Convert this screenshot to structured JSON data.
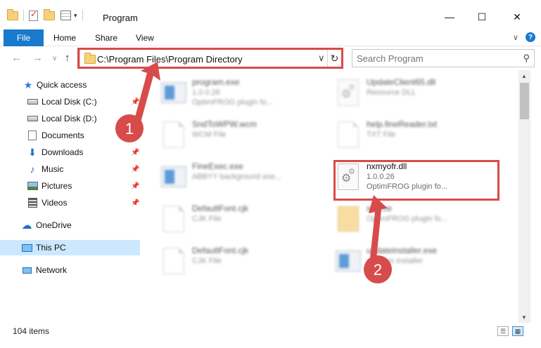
{
  "window": {
    "title": "Program",
    "minimize_glyph": "—",
    "maximize_glyph": "☐",
    "close_glyph": "✕"
  },
  "ribbon": {
    "tabs": [
      "File",
      "Home",
      "Share",
      "View"
    ],
    "expand_glyph": "∨",
    "help_glyph": "?"
  },
  "nav": {
    "back_glyph": "←",
    "forward_glyph": "→",
    "recent_glyph": "∨",
    "up_glyph": "↑",
    "address": "C:\\Program Files\\Program Directory",
    "address_dropdown_glyph": "∨",
    "refresh_glyph": "↻",
    "search_placeholder": "Search Program",
    "search_glyph": "⚲"
  },
  "sidebar": {
    "items": [
      {
        "label": "Quick access",
        "icon": "star-icon"
      },
      {
        "label": "Local Disk (C:)",
        "icon": "drive-icon"
      },
      {
        "label": "Local Disk (D:)",
        "icon": "drive-icon"
      },
      {
        "label": "Documents",
        "icon": "documents-icon"
      },
      {
        "label": "Downloads",
        "icon": "download-icon"
      },
      {
        "label": "Music",
        "icon": "music-icon"
      },
      {
        "label": "Pictures",
        "icon": "pictures-icon"
      },
      {
        "label": "Videos",
        "icon": "videos-icon"
      },
      {
        "label": "OneDrive",
        "icon": "cloud-icon"
      },
      {
        "label": "This PC",
        "icon": "computer-icon"
      },
      {
        "label": "Network",
        "icon": "network-icon"
      }
    ]
  },
  "files": [
    {
      "name": "program.exe",
      "line2": "1.0.0.26",
      "line3": "OptimFROG plugin fo...",
      "icon": "exe-icon"
    },
    {
      "name": "UpdateClient65.dll",
      "line2": "Resource DLL",
      "line3": "",
      "icon": "dll-icon"
    },
    {
      "name": "SndToWPW.wcm",
      "line2": "WCM File",
      "line3": "",
      "icon": "file-icon"
    },
    {
      "name": "help.fineReader.txt",
      "line2": "TXT File",
      "line3": "",
      "icon": "file-icon"
    },
    {
      "name": "FineExec.exe",
      "line2": "ABBYY background exe...",
      "line3": "",
      "icon": "exe-icon"
    },
    {
      "name": "nxmyofr.dll",
      "line2": "1.0.0.26",
      "line3": "OptimFROG plugin fo...",
      "icon": "dll-icon"
    },
    {
      "name": "DefaultFont.cjk",
      "line2": "CJK File",
      "line3": "",
      "icon": "file-icon"
    },
    {
      "name": "source",
      "line2": "OptimFROG plugin fo...",
      "line3": "",
      "icon": "folder-icon"
    },
    {
      "name": "DefaultFont.cjk",
      "line2": "CJK File",
      "line3": "",
      "icon": "file-icon"
    },
    {
      "name": "updateinstaller.exe",
      "line2": "updates installer",
      "line3": "",
      "icon": "exe-icon"
    }
  ],
  "annotations": {
    "step1": "1",
    "step2": "2",
    "accent": "#d84b4b"
  },
  "status": {
    "count": "104 items"
  }
}
